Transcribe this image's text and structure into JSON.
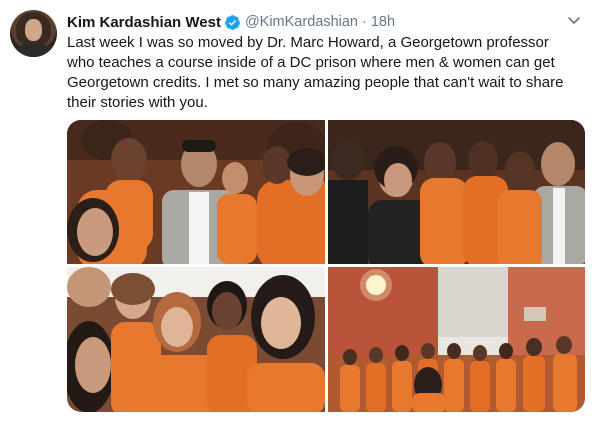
{
  "tweet": {
    "author_name": "Kim Kardashian West",
    "handle": "@KimKardashian",
    "separator": "·",
    "time": "18h",
    "text_lines": [
      "Last week I was so moved by Dr. Marc Howard,  a Georgetown professor",
      "who teaches a course inside of a DC prison where men & women can get",
      "Georgetown credits. I met so many amazing people that can't wait to share",
      "their stories with you."
    ]
  },
  "icons": {
    "verified": "verified-badge-icon",
    "more": "chevron-down-icon"
  },
  "colors": {
    "verified_blue": "#1da1f2",
    "secondary_text": "#657786",
    "primary_text": "#14171a",
    "uniform_orange": "#e8782d"
  }
}
